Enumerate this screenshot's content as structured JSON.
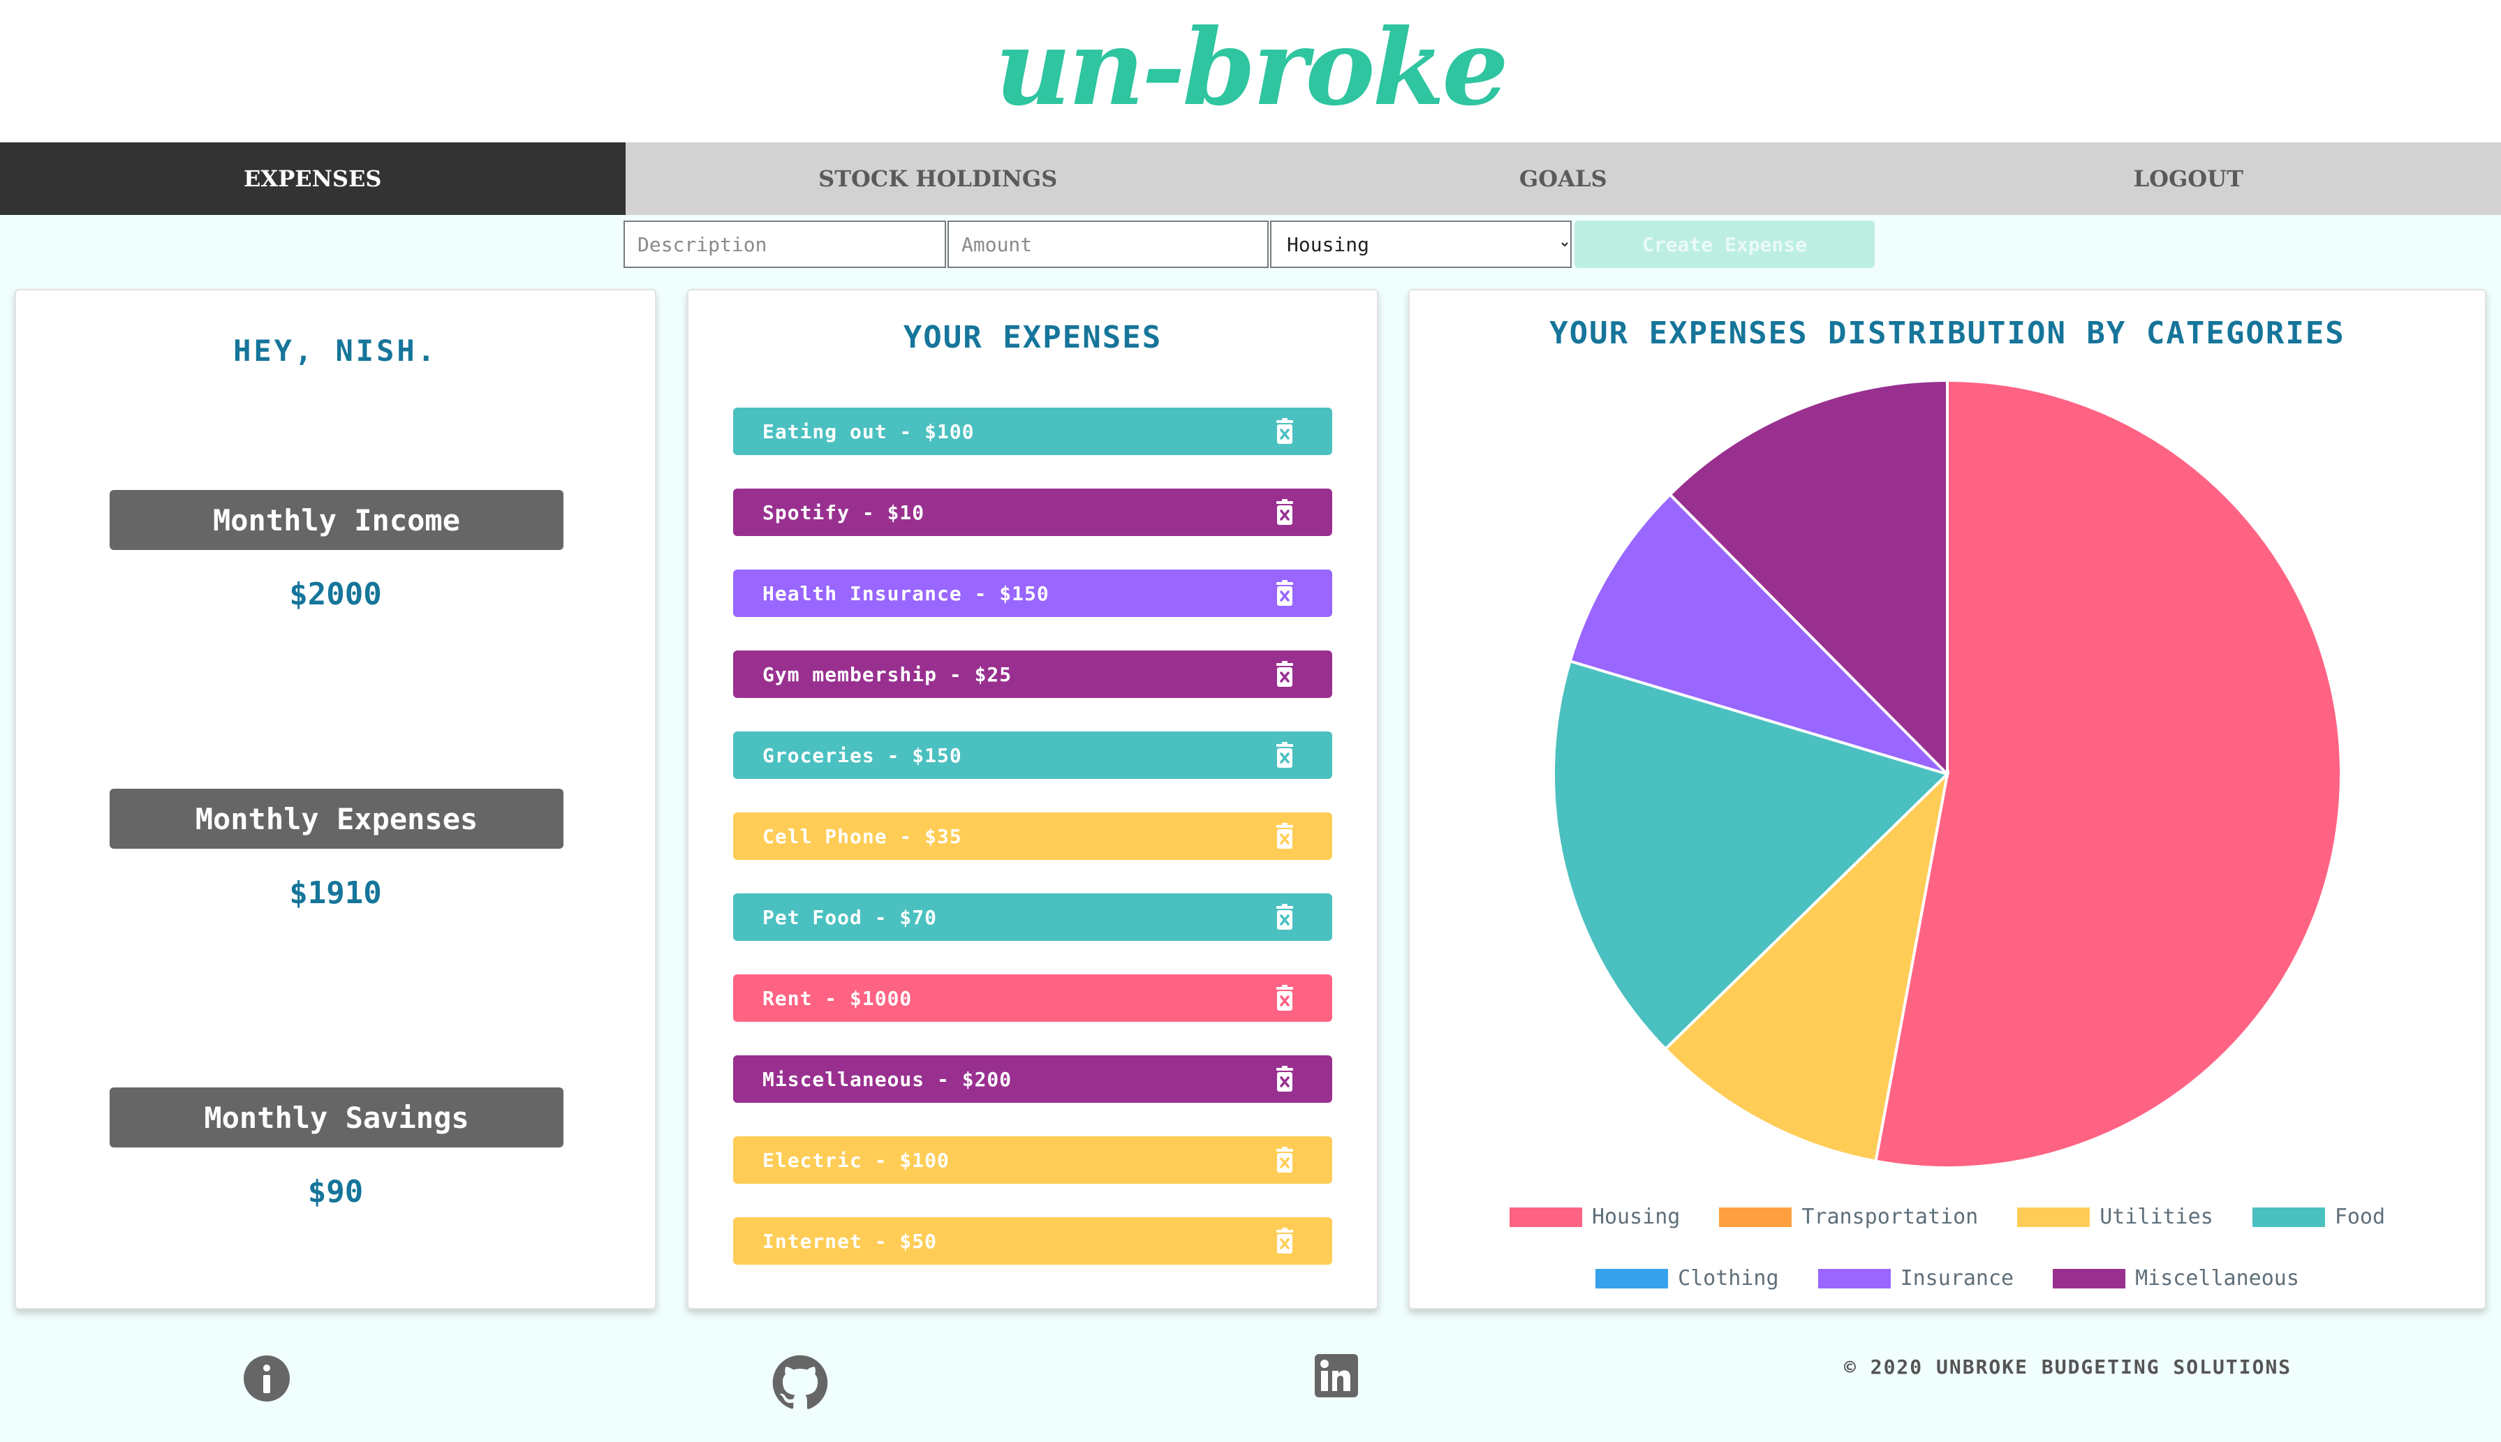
{
  "app": {
    "logo_text": "un-broke"
  },
  "nav": [
    {
      "label": "EXPENSES",
      "active": true
    },
    {
      "label": "STOCK HOLDINGS",
      "active": false
    },
    {
      "label": "GOALS",
      "active": false
    },
    {
      "label": "LOGOUT",
      "active": false
    }
  ],
  "form": {
    "description_placeholder": "Description",
    "description_value": "",
    "amount_placeholder": "Amount",
    "amount_value": "",
    "category_selected": "Housing",
    "create_label": "Create Expense"
  },
  "summary": {
    "greeting": "HEY, NISH.",
    "income_label": "Monthly Income",
    "income_value": "$2000",
    "expenses_label": "Monthly Expenses",
    "expenses_value": "$1910",
    "savings_label": "Monthly Savings",
    "savings_value": "$90"
  },
  "expenses": {
    "title": "YOUR EXPENSES",
    "items": [
      {
        "label": "Eating out - $100",
        "color": "#4bc0c0"
      },
      {
        "label": "Spotify - $10",
        "color": "#993090"
      },
      {
        "label": "Health Insurance - $150",
        "color": "#9966ff"
      },
      {
        "label": "Gym membership - $25",
        "color": "#993090"
      },
      {
        "label": "Groceries - $150",
        "color": "#4bc0c0"
      },
      {
        "label": "Cell Phone - $35",
        "color": "#ffcd56"
      },
      {
        "label": "Pet Food - $70",
        "color": "#4bc0c0"
      },
      {
        "label": "Rent - $1000",
        "color": "#ff6384"
      },
      {
        "label": "Miscellaneous - $200",
        "color": "#993090"
      },
      {
        "label": "Electric - $100",
        "color": "#ffcd56"
      },
      {
        "label": "Internet - $50",
        "color": "#ffcd56"
      }
    ]
  },
  "distribution": {
    "title": "YOUR EXPENSES DISTRIBUTION BY CATEGORIES"
  },
  "chart_data": {
    "type": "pie",
    "title": "YOUR EXPENSES DISTRIBUTION BY CATEGORIES",
    "categories": [
      "Housing",
      "Transportation",
      "Utilities",
      "Food",
      "Clothing",
      "Insurance",
      "Miscellaneous"
    ],
    "values": [
      1000,
      0,
      185,
      320,
      0,
      150,
      235
    ],
    "colors": [
      "#ff6384",
      "#ff9f40",
      "#ffcd56",
      "#4bc0c0",
      "#36a2eb",
      "#9966ff",
      "#993090"
    ],
    "legend": "bottom"
  },
  "footer": {
    "copyright": "© 2020 UNBROKE BUDGETING SOLUTIONS",
    "icons": [
      "info-icon",
      "github-icon",
      "linkedin-icon"
    ]
  }
}
